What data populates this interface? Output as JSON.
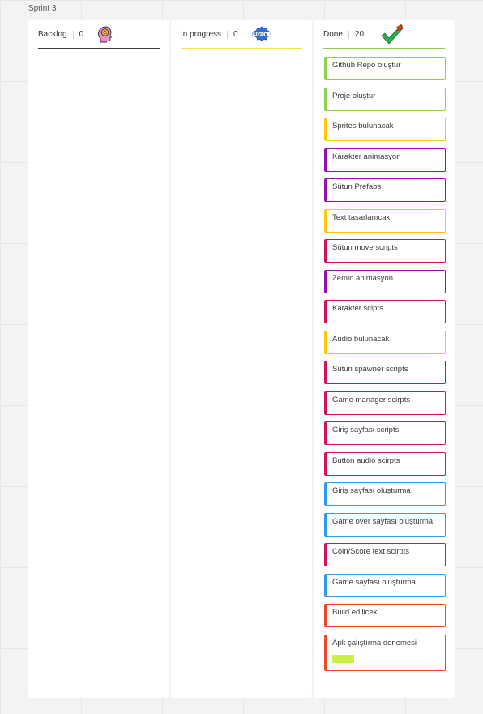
{
  "frame": {
    "title": "Sprint 3"
  },
  "columns": [
    {
      "title": "Backlog",
      "count": "0",
      "icon": "brain-icon",
      "line_color": "#3a3a3a"
    },
    {
      "title": "In progress",
      "count": "0",
      "icon": "review-badge-icon",
      "line_color": "#f1e153"
    },
    {
      "title": "Done",
      "count": "20",
      "icon": "checkmark-icon",
      "line_color": "#8fd14f"
    }
  ],
  "done_cards": [
    {
      "label": "Github Repo oluştur",
      "color": "#8fd14f"
    },
    {
      "label": "Proje oluştur",
      "color": "#8fd14f"
    },
    {
      "label": "Sprites bulunacak",
      "color": "#fac710"
    },
    {
      "label": "Karakter animasyon",
      "color": "#9510ac"
    },
    {
      "label": "Sütun Prefabs",
      "color": "#9510ac"
    },
    {
      "label": "Text tasarlanıcak",
      "color": "#fac710"
    },
    {
      "label": "Sütun move scripts",
      "color": "#d5105c"
    },
    {
      "label": "Zemin animasyon",
      "color": "#9510ac"
    },
    {
      "label": "Karakter scipts",
      "color": "#d5105c"
    },
    {
      "label": "Audio bulunacak",
      "color": "#fac710"
    },
    {
      "label": "Sütun spawner scripts",
      "color": "#d5105c"
    },
    {
      "label": "Game manager scirpts",
      "color": "#d5105c"
    },
    {
      "label": "Giriş sayfası scripts",
      "color": "#d5105c"
    },
    {
      "label": "Button audio scirpts",
      "color": "#d5105c"
    },
    {
      "label": "Giriş sayfası oluşturma",
      "color": "#2d9bf0"
    },
    {
      "label": " Game over sayfası oluşturma",
      "color": "#2d9bf0"
    },
    {
      "label": "Coin/Score text scirpts",
      "color": "#d5105c"
    },
    {
      "label": " Game sayfası oluşturma",
      "color": "#2d9bf0"
    },
    {
      "label": "Build edilicek",
      "color": "#f24726"
    },
    {
      "label": "Apk çalıştırma denemesi",
      "color": "#f24726",
      "tag_color": "#cbef43"
    }
  ]
}
